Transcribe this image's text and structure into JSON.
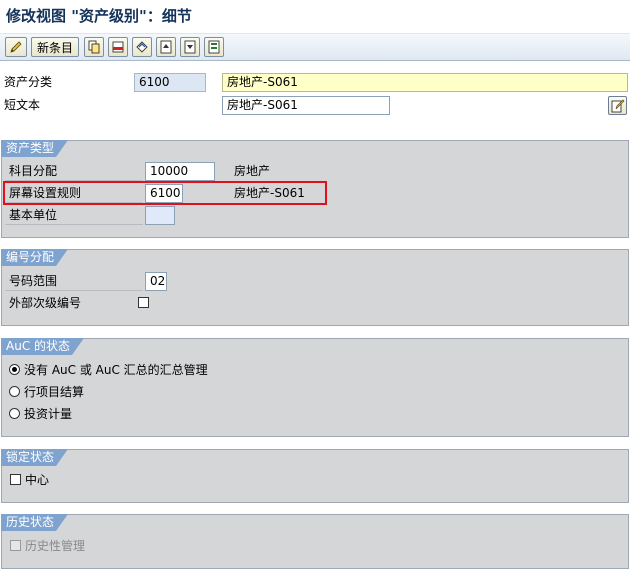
{
  "window": {
    "title": "修改视图 \"资产级别\"：细节"
  },
  "toolbar": {
    "new_entries_label": "新条目",
    "buttons": [
      {
        "name": "display-change-icon"
      },
      {
        "name": "copy-icon"
      },
      {
        "name": "delete-icon"
      },
      {
        "name": "undo-icon"
      },
      {
        "name": "previous-entry-icon"
      },
      {
        "name": "next-entry-icon"
      },
      {
        "name": "select-all-icon"
      }
    ]
  },
  "header": {
    "asset_class_label": "资产分类",
    "asset_class_value": "6100",
    "asset_class_desc": "房地产-S061",
    "short_text_label": "短文本",
    "short_text_value": "房地产-S061"
  },
  "asset_type": {
    "title": "资产类型",
    "account_determination_label": "科目分配",
    "account_determination_value": "10000",
    "account_determination_desc": "房地产",
    "screen_layout_label": "屏幕设置规则",
    "screen_layout_value": "6100",
    "screen_layout_desc": "房地产-S061",
    "base_unit_label": "基本单位",
    "base_unit_value": ""
  },
  "number_assignment": {
    "title": "编号分配",
    "number_range_label": "号码范围",
    "number_range_value": "02",
    "external_subnumber_label": "外部次级编号"
  },
  "auc_status": {
    "title": "AuC 的状态",
    "options": [
      {
        "label": "没有 AuC 或 AuC 汇总的汇总管理",
        "checked": true
      },
      {
        "label": "行项目结算",
        "checked": false
      },
      {
        "label": "投资计量",
        "checked": false
      }
    ]
  },
  "lock_status": {
    "title": "锁定状态",
    "locked_label": "中心"
  },
  "history_status": {
    "title": "历史状态",
    "history_management_label": "历史性管理"
  },
  "colors": {
    "title_text": "#14335b",
    "group_tab": "#7fa3cf",
    "group_bg": "#d4d6d8",
    "highlight": "#e0101c",
    "required_field": "#ffffc8"
  }
}
